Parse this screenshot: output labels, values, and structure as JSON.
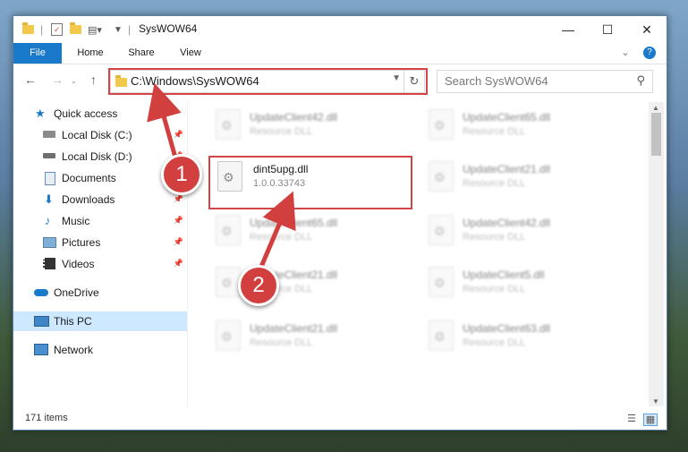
{
  "window": {
    "title": "SysWOW64"
  },
  "window_controls": {
    "minimize": "—",
    "maximize": "☐",
    "close": "✕"
  },
  "ribbon": {
    "tabs": [
      "File",
      "Home",
      "Share",
      "View"
    ],
    "help": "?"
  },
  "nav": {
    "back": "←",
    "forward": "→",
    "up": "↑",
    "address": "C:\\Windows\\SysWOW64",
    "search_placeholder": "Search SysWOW64"
  },
  "sidebar": {
    "items": [
      {
        "label": "Quick access",
        "icon": "star-icon"
      },
      {
        "label": "Local Disk (C:)",
        "icon": "disk-icon"
      },
      {
        "label": "Local Disk (D:)",
        "icon": "disk-icon"
      },
      {
        "label": "Documents",
        "icon": "documents-icon"
      },
      {
        "label": "Downloads",
        "icon": "download-icon"
      },
      {
        "label": "Music",
        "icon": "music-icon"
      },
      {
        "label": "Pictures",
        "icon": "pictures-icon"
      },
      {
        "label": "Videos",
        "icon": "videos-icon"
      },
      {
        "label": "OneDrive",
        "icon": "cloud-icon"
      },
      {
        "label": "This PC",
        "icon": "pc-icon"
      },
      {
        "label": "Network",
        "icon": "network-icon"
      }
    ]
  },
  "files": [
    {
      "name": "UpdateClient42.dll",
      "type": "Resource DLL"
    },
    {
      "name": "UpdateClient65.dll",
      "type": "Resource DLL"
    },
    {
      "name": "dint5upg.dll",
      "type": "1.0.0.33743"
    },
    {
      "name": "UpdateClient21.dll",
      "type": "Resource DLL"
    },
    {
      "name": "UpdateClient65.dll",
      "type": "Resource DLL"
    },
    {
      "name": "UpdateClient42.dll",
      "type": "Resource DLL"
    },
    {
      "name": "UpdateClient21.dll",
      "type": "Resource DLL"
    },
    {
      "name": "UpdateClient5.dll",
      "type": "Resource DLL"
    },
    {
      "name": "UpdateClient21.dll",
      "type": "Resource DLL"
    },
    {
      "name": "UpdateClient63.dll",
      "type": "Resource DLL"
    }
  ],
  "status": {
    "count": "171 items"
  },
  "annotations": {
    "step1": "1",
    "step2": "2",
    "color": "#d64545"
  }
}
